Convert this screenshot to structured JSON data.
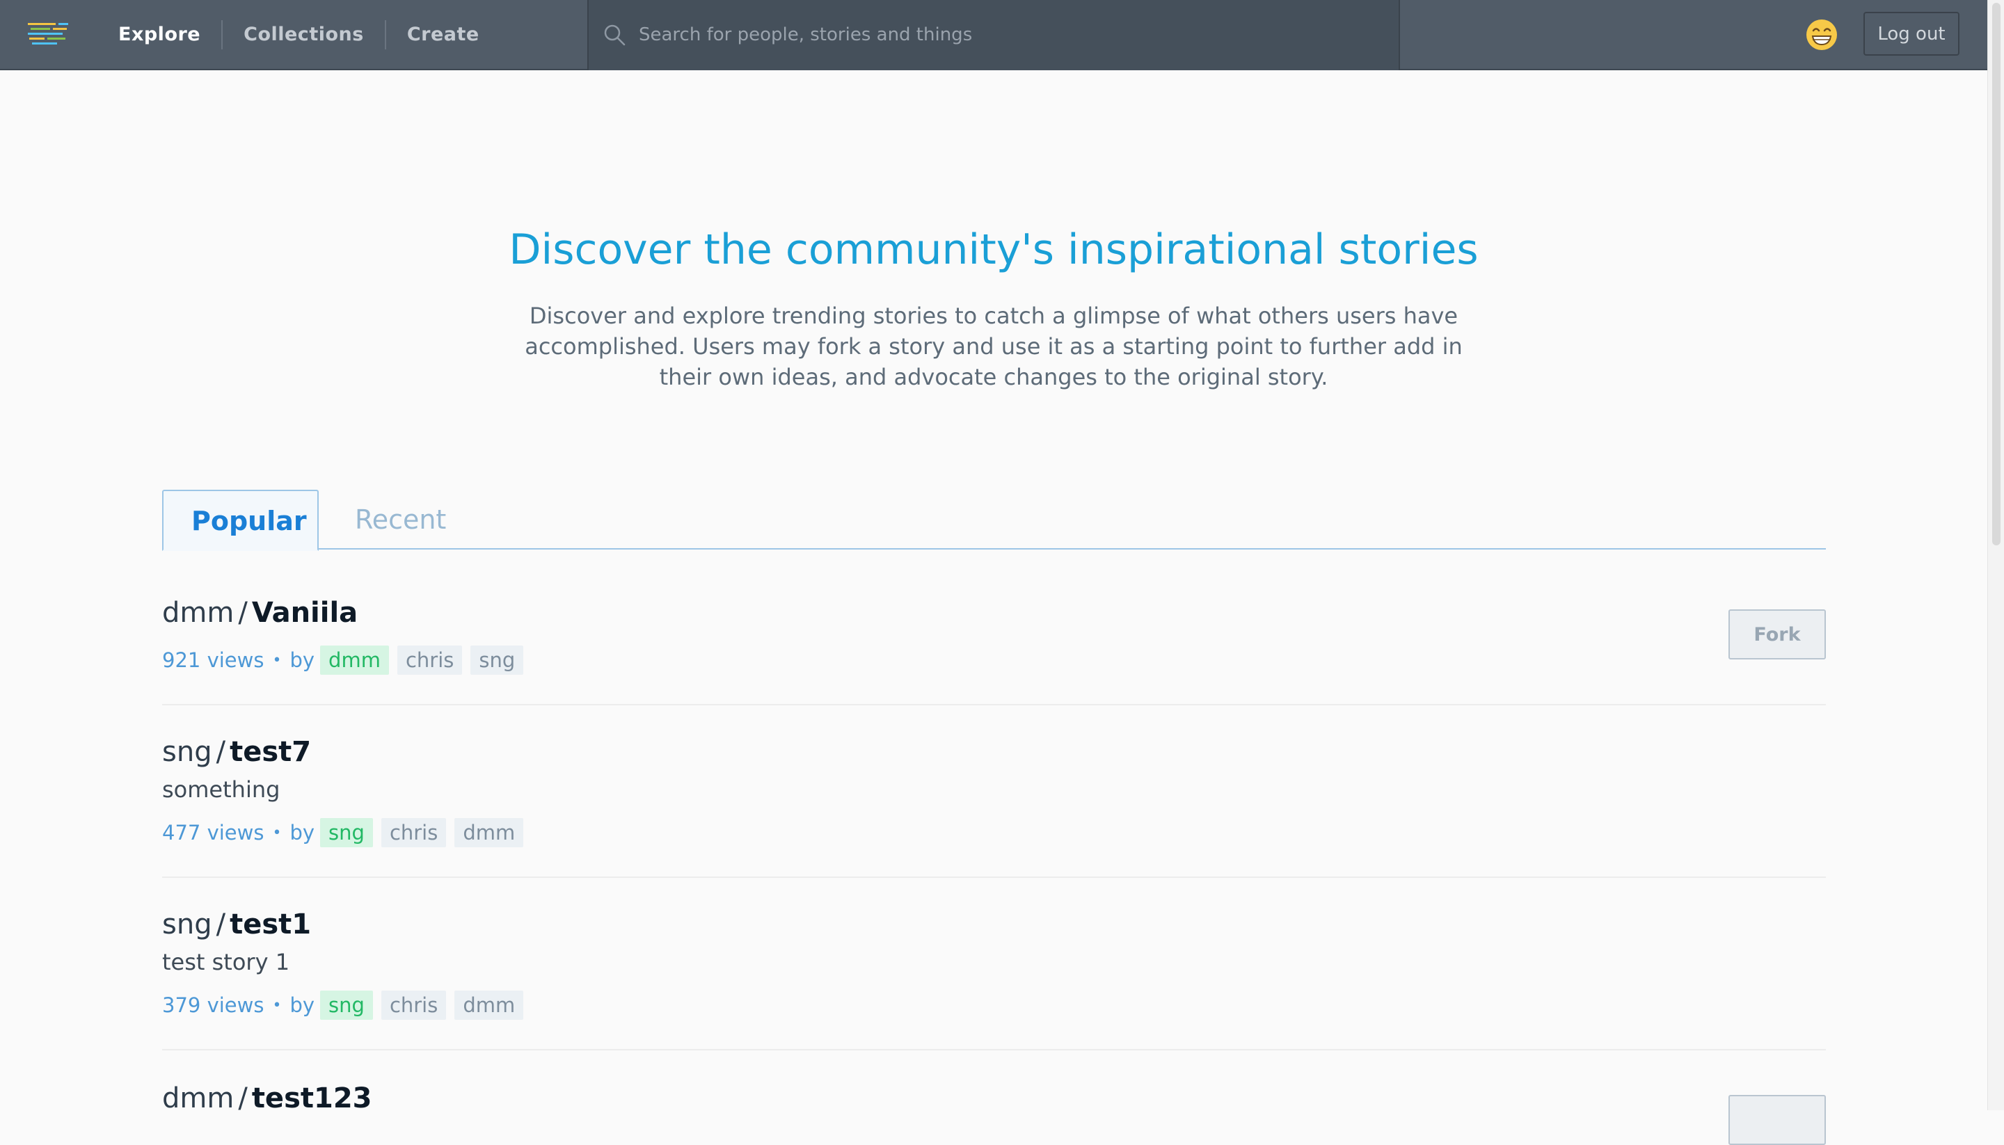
{
  "nav": {
    "items": [
      {
        "label": "Explore",
        "active": true
      },
      {
        "label": "Collections",
        "active": false
      },
      {
        "label": "Create",
        "active": false
      }
    ],
    "search_placeholder": "Search for people, stories and things",
    "avatar_icon": "grinning-face-emoji",
    "logout_label": "Log out"
  },
  "hero": {
    "title": "Discover the community's inspirational stories",
    "description": "Discover and explore trending stories to catch a glimpse of what others users have accomplished. Users may fork a story and use it as a starting point to further add in their own ideas, and advocate changes to the original story."
  },
  "tabs": [
    {
      "label": "Popular",
      "active": true
    },
    {
      "label": "Recent",
      "active": false
    }
  ],
  "stories": [
    {
      "owner": "dmm",
      "name": "Vaniila",
      "description": "",
      "views": "921 views",
      "by": "by",
      "contributors": [
        "dmm",
        "chris",
        "sng"
      ],
      "fork_label": "Fork"
    },
    {
      "owner": "sng",
      "name": "test7",
      "description": "something",
      "views": "477 views",
      "by": "by",
      "contributors": [
        "sng",
        "chris",
        "dmm"
      ]
    },
    {
      "owner": "sng",
      "name": "test1",
      "description": "test story 1",
      "views": "379 views",
      "by": "by",
      "contributors": [
        "sng",
        "chris",
        "dmm"
      ]
    },
    {
      "owner": "dmm",
      "name": "test123",
      "description": "",
      "views": "",
      "by": "",
      "contributors": []
    }
  ],
  "colors": {
    "topbar": "#515c68",
    "accent": "#1a9fd6",
    "owner_chip": "#22b864",
    "meta_text": "#4d98d6"
  }
}
